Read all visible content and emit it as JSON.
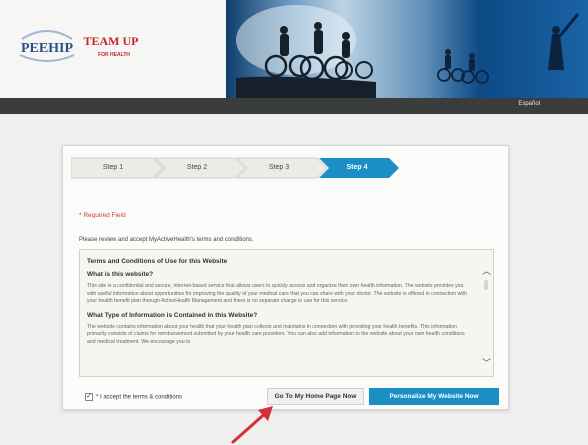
{
  "header": {
    "logo_primary": "PEEHIP",
    "logo_secondary": "TEAM UP",
    "logo_secondary_tagline": "FOR HEALTH",
    "language_link": "Español"
  },
  "steps": [
    {
      "label": "Step 1"
    },
    {
      "label": "Step 2"
    },
    {
      "label": "Step 3"
    },
    {
      "label": "Step 4",
      "active": true
    }
  ],
  "form": {
    "required_note": "* Required Field",
    "intro": "Please review and accept MyActiveHealth's terms and conditions.",
    "terms_title": "Terms and Conditions of Use for this Website",
    "section1_heading": "What is this website?",
    "section1_body": "This site is a confidential and secure, internet-based service that allows users to quickly access and organize their own health information. The website provides you with useful information about opportunities for improving the quality of your medical care that you can share with your doctor. The website is offered in connection with your health benefit plan through ActiveHealth Management and there is no separate charge to use for this service.",
    "section2_heading": "What Type of Information is Contained in this Website?",
    "section2_body": "The website contains information about your health that your health plan collects and maintains in connection with providing your health benefits. This information primarily consists of claims for reimbursement submitted by your health care providers. You can also add information to the website about your own health conditions and medical treatment. We encourage you to",
    "accept_label": "* I accept the terms & conditions",
    "checkbox_mark": "✓",
    "btn_home": "Go To My Home Page Now",
    "btn_personalize": "Personalize My Website Now",
    "scroll_up": "︿",
    "scroll_down": "﹀"
  },
  "colors": {
    "accent": "#1b8ec6",
    "required": "#d23b36",
    "annotation_arrow": "#d62d3a",
    "header_bar": "#3b3d3c"
  }
}
